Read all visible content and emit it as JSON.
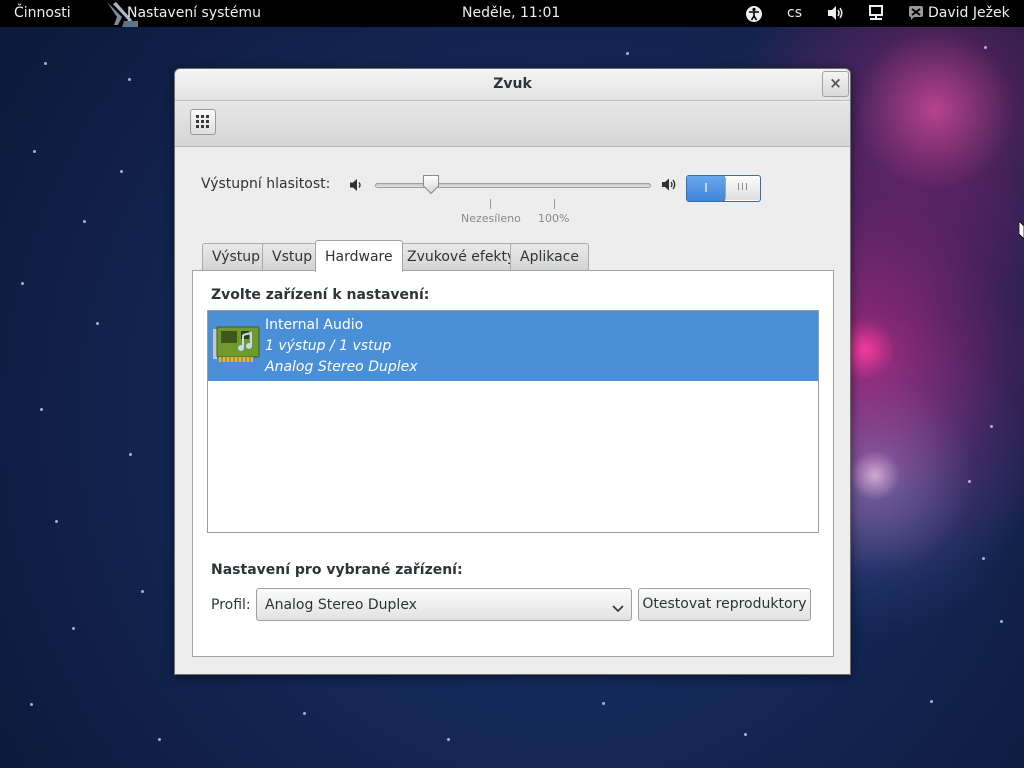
{
  "topbar": {
    "activities": "Činnosti",
    "app_menu": "Nastavení systému",
    "clock": "Neděle, 11:01",
    "language": "cs",
    "user": "David Ježek"
  },
  "window": {
    "title": "Zvuk",
    "close_glyph": "×"
  },
  "volume": {
    "label": "Výstupní hlasitost:",
    "level_percent": 20,
    "tick_unamplified": "Nezesíleno",
    "tick_100": "100%",
    "switch_on": "I",
    "switch_off_glyph": "III"
  },
  "tabs": [
    {
      "label": "Výstup",
      "active": false
    },
    {
      "label": "Vstup",
      "active": false
    },
    {
      "label": "Hardware",
      "active": true
    },
    {
      "label": "Zvukové efekty",
      "active": false
    },
    {
      "label": "Aplikace",
      "active": false
    }
  ],
  "hardware": {
    "choose_label": "Zvolte zařízení k nastavení:",
    "devices": [
      {
        "name": "Internal Audio",
        "ports": "1 výstup / 1 vstup",
        "profile": "Analog Stereo Duplex",
        "selected": true
      }
    ],
    "settings_label": "Nastavení pro vybrané zařízení:",
    "profile_label": "Profil:",
    "profile_value": "Analog Stereo Duplex",
    "test_button": "Otestovat reproduktory"
  },
  "icons": {
    "accessibility": "accessibility-icon",
    "volume": "speaker-icon",
    "network": "network-wired-icon",
    "user": "user-chat-icon",
    "grid": "show-all-icon",
    "sound_card": "audio-card-icon"
  },
  "colors": {
    "selection": "#4a90d9",
    "switch_on": "#4a90d9",
    "topbar": "#000000"
  }
}
